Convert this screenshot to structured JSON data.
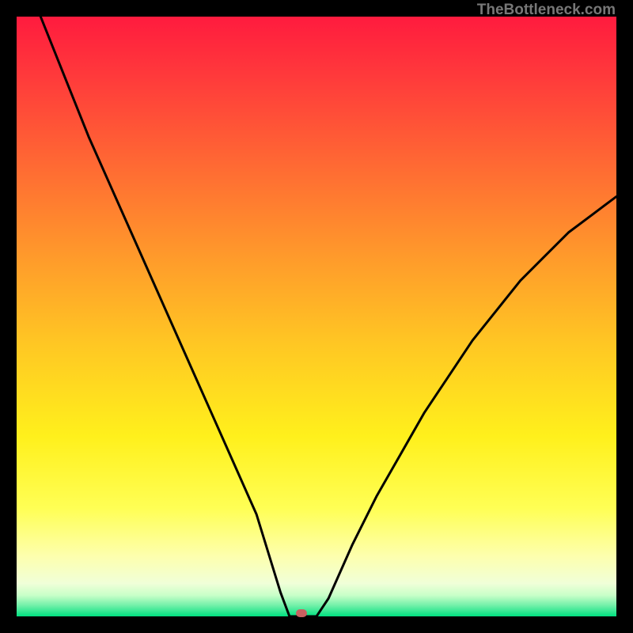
{
  "watermark": "TheBottleneck.com",
  "marker": {
    "x_frac": 0.475,
    "y_frac": 0.995
  },
  "chart_data": {
    "type": "line",
    "title": "",
    "xlabel": "",
    "ylabel": "",
    "xlim": [
      0,
      1
    ],
    "ylim": [
      0,
      1
    ],
    "series": [
      {
        "name": "bottleneck-curve",
        "x": [
          0.04,
          0.08,
          0.12,
          0.16,
          0.2,
          0.24,
          0.28,
          0.32,
          0.36,
          0.4,
          0.44,
          0.455,
          0.5,
          0.52,
          0.56,
          0.6,
          0.64,
          0.68,
          0.72,
          0.76,
          0.8,
          0.84,
          0.88,
          0.92,
          0.96,
          1.0
        ],
        "y": [
          1.0,
          0.9,
          0.8,
          0.71,
          0.62,
          0.53,
          0.44,
          0.35,
          0.26,
          0.17,
          0.04,
          0.0,
          0.0,
          0.03,
          0.12,
          0.2,
          0.27,
          0.34,
          0.4,
          0.46,
          0.51,
          0.56,
          0.6,
          0.64,
          0.67,
          0.7
        ]
      }
    ],
    "background_gradient": {
      "stops": [
        {
          "offset": 0.0,
          "color": "#ff1b3e"
        },
        {
          "offset": 0.1,
          "color": "#ff3a3b"
        },
        {
          "offset": 0.25,
          "color": "#ff6a33"
        },
        {
          "offset": 0.4,
          "color": "#ff9a2b"
        },
        {
          "offset": 0.55,
          "color": "#ffc823"
        },
        {
          "offset": 0.7,
          "color": "#fff01c"
        },
        {
          "offset": 0.82,
          "color": "#ffff55"
        },
        {
          "offset": 0.9,
          "color": "#fdffae"
        },
        {
          "offset": 0.945,
          "color": "#f0ffd8"
        },
        {
          "offset": 0.965,
          "color": "#c8ffc8"
        },
        {
          "offset": 0.982,
          "color": "#70f0a8"
        },
        {
          "offset": 1.0,
          "color": "#00e080"
        }
      ]
    }
  }
}
